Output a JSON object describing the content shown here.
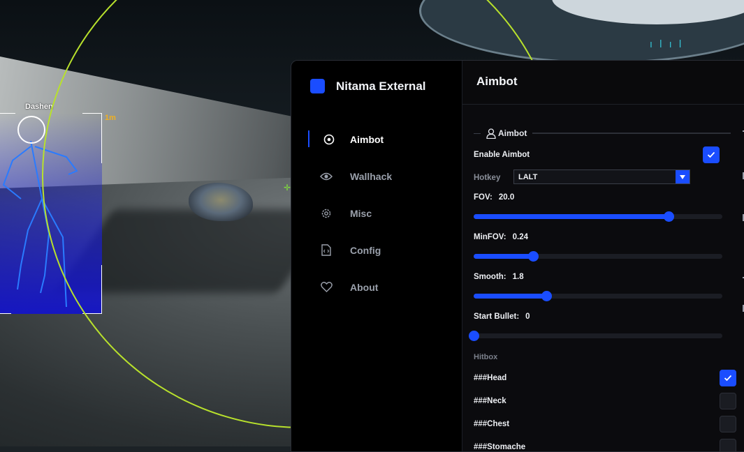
{
  "game": {
    "target_name": "Dashen",
    "target_distance": "1m"
  },
  "brand": {
    "name": "Nitama External",
    "accent": "#1a4dff"
  },
  "nav": [
    {
      "label": "Aimbot",
      "icon": "target-icon",
      "active": true
    },
    {
      "label": "Wallhack",
      "icon": "eye-icon",
      "active": false
    },
    {
      "label": "Misc",
      "icon": "gear-icon",
      "active": false
    },
    {
      "label": "Config",
      "icon": "file-code-icon",
      "active": false
    },
    {
      "label": "About",
      "icon": "heart-icon",
      "active": false
    }
  ],
  "content": {
    "title": "Aimbot",
    "group": {
      "title": "Aimbot",
      "icon": "user-icon"
    },
    "enable": {
      "label": "Enable Aimbot",
      "checked": true
    },
    "hotkey": {
      "label": "Hotkey",
      "value": "LALT"
    },
    "sliders": [
      {
        "label": "FOV:",
        "value": "20.0",
        "fraction": 0.785
      },
      {
        "label": "MinFOV:",
        "value": "0.24",
        "fraction": 0.24
      },
      {
        "label": "Smooth:",
        "value": "1.8",
        "fraction": 0.293
      },
      {
        "label": "Start Bullet:",
        "value": "0",
        "fraction": 0.0
      }
    ],
    "hitbox": {
      "label": "Hitbox",
      "items": [
        {
          "label": "###Head",
          "checked": true
        },
        {
          "label": "###Neck",
          "checked": false
        },
        {
          "label": "###Chest",
          "checked": false
        },
        {
          "label": "###Stomache",
          "checked": false
        }
      ]
    }
  }
}
